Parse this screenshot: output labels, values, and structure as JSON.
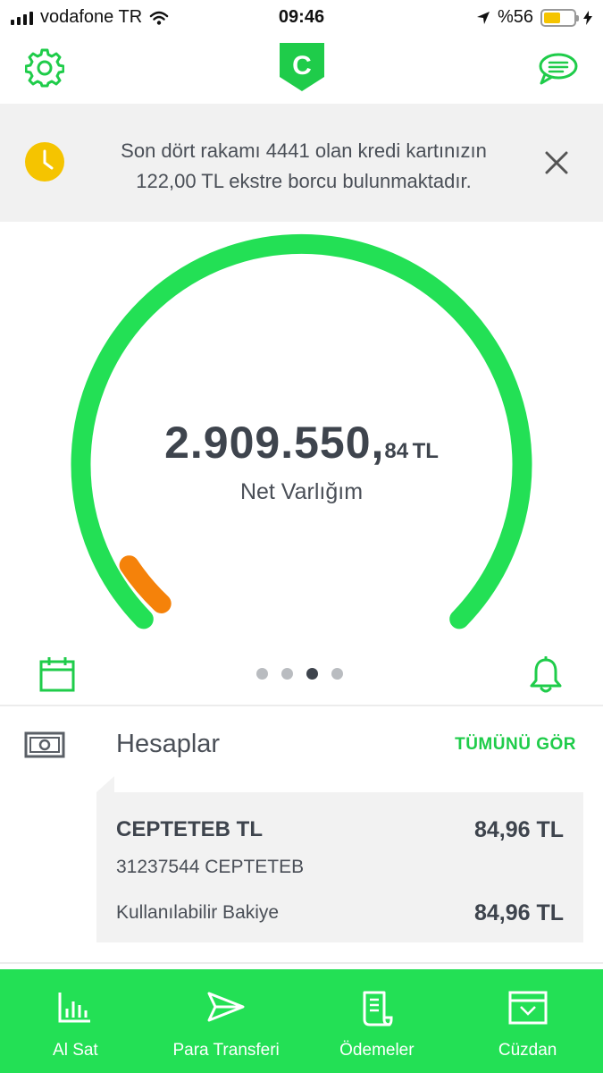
{
  "status_bar": {
    "carrier": "vodafone TR",
    "time": "09:46",
    "battery_text": "%56",
    "battery_level": 0.56
  },
  "header": {
    "logo_letter": "C",
    "settings_icon": "gear-icon",
    "messages_icon": "chat-bubble-icon"
  },
  "banner": {
    "line1": "Son dört rakamı 4441 olan kredi kartınızın",
    "line2": "122,00 TL ekstre borcu bulunmaktadır.",
    "icon": "clock-icon",
    "close_icon": "close-icon"
  },
  "net_worth": {
    "integer_part": "2.909.550,",
    "decimal_part": "84",
    "currency": "TL",
    "label": "Net Varlığım"
  },
  "gauge": {
    "main_color": "#23e055",
    "debt_color": "#f5820a"
  },
  "pager": {
    "count": 4,
    "active_index": 2
  },
  "accounts": {
    "title": "Hesaplar",
    "see_all": "TÜMÜNÜ GÖR",
    "items": [
      {
        "name": "CEPTETEB TL",
        "amount": "84,96 TL",
        "number": "31237544 CEPTETEB",
        "available_label": "Kullanılabilir Bakiye",
        "available_amount": "84,96 TL"
      }
    ]
  },
  "tabbar": {
    "items": [
      {
        "label": "Al Sat",
        "icon": "bar-chart-icon"
      },
      {
        "label": "Para Transferi",
        "icon": "send-icon"
      },
      {
        "label": "Ödemeler",
        "icon": "receipt-icon"
      },
      {
        "label": "Cüzdan",
        "icon": "wallet-icon"
      }
    ]
  },
  "colors": {
    "brand_green": "#23e055",
    "accent_text_green": "#1fcc4a",
    "clock_yellow": "#f5c400"
  }
}
